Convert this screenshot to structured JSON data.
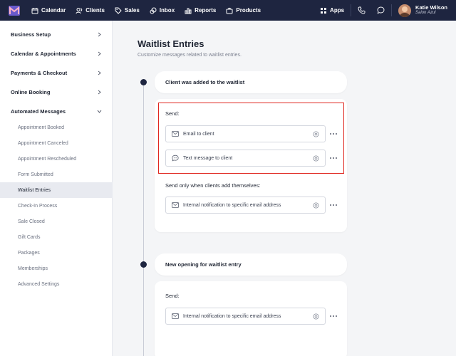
{
  "nav": {
    "items": [
      {
        "label": "Calendar",
        "icon": "calendar-icon"
      },
      {
        "label": "Clients",
        "icon": "clients-icon"
      },
      {
        "label": "Sales",
        "icon": "sales-tag-icon"
      },
      {
        "label": "Inbox",
        "icon": "inbox-icon"
      },
      {
        "label": "Reports",
        "icon": "reports-icon"
      },
      {
        "label": "Products",
        "icon": "products-bag-icon"
      }
    ],
    "apps_label": "Apps",
    "user_name": "Katie Wilson",
    "user_business": "Salon Azul"
  },
  "sidebar": {
    "sections": [
      {
        "label": "Business Setup",
        "expanded": false
      },
      {
        "label": "Calendar & Appointments",
        "expanded": false
      },
      {
        "label": "Payments & Checkout",
        "expanded": false
      },
      {
        "label": "Online Booking",
        "expanded": false
      },
      {
        "label": "Automated Messages",
        "expanded": true
      }
    ],
    "subitems": [
      "Appointment Booked",
      "Appointment Canceled",
      "Appointment Rescheduled",
      "Form Submitted",
      "Waitlist Entries",
      "Check-In Process",
      "Sale Closed",
      "Gift Cards",
      "Packages",
      "Memberships",
      "Advanced Settings"
    ],
    "active_subitem": "Waitlist Entries"
  },
  "page": {
    "title": "Waitlist Entries",
    "subtitle": "Customize messages related to waitlist entries."
  },
  "events": [
    {
      "title": "Client was added to the waitlist",
      "send_label": "Send:",
      "messages": [
        {
          "label": "Email to client",
          "icon": "envelope-icon"
        },
        {
          "label": "Text message to client",
          "icon": "chat-bubble-icon"
        }
      ],
      "conditional_label": "Send only when clients add themselves:",
      "conditional_messages": [
        {
          "label": "Internal notification to specific email address",
          "icon": "envelope-icon"
        }
      ]
    },
    {
      "title": "New opening for waitlist entry",
      "send_label": "Send:",
      "messages": [
        {
          "label": "Internal notification to specific email address",
          "icon": "envelope-icon"
        }
      ]
    }
  ],
  "colors": {
    "nav_bg": "#1e2540",
    "highlight": "#e0261f",
    "active_bg": "#e8eaf0"
  }
}
